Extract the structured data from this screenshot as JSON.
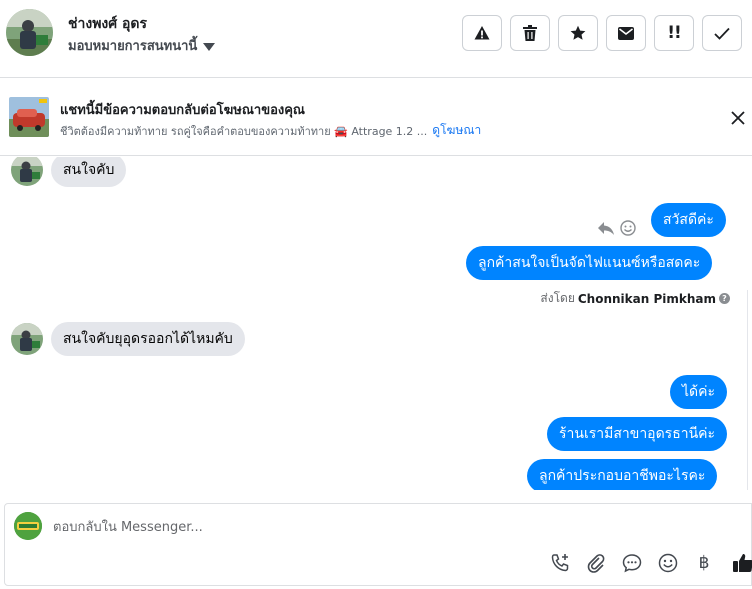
{
  "header": {
    "contact_name": "ช่างพงศ์ อุดร",
    "assign_label": "มอบหมายการสนทนานี้",
    "actions": [
      {
        "name": "spam",
        "icon": "warning-icon"
      },
      {
        "name": "delete",
        "icon": "trash-icon"
      },
      {
        "name": "star",
        "icon": "star-icon"
      },
      {
        "name": "mark-unread",
        "icon": "envelope-icon"
      },
      {
        "name": "follow-up",
        "icon": "exclamation-icon",
        "label": "!!"
      },
      {
        "name": "done",
        "icon": "check-icon"
      }
    ]
  },
  "ad": {
    "title": "แชทนี้มีข้อความตอบกลับต่อโฆษณาของคุณ",
    "subtitle": "ชีวิตต้องมีความท้าทาย รถคู่ใจคือคำตอบของความท้าทาย 🚘 Attrage 1.2 ...",
    "link": "ดูโฆษณา"
  },
  "messages": [
    {
      "from": "customer",
      "text": "สนใจคับ"
    },
    {
      "from": "page",
      "text": "สวัสดีค่ะ"
    },
    {
      "from": "page",
      "text": "ลูกค้าสนใจเป็นจัดไฟแนนซ์หรือสดคะ"
    },
    {
      "from": "customer",
      "text": "สนใจคับยุอุดรออกได้ไหมคับ"
    },
    {
      "from": "page",
      "text": "ได้ค่ะ"
    },
    {
      "from": "page",
      "text": "ร้านเรามีสาขาอุดรธานีค่ะ"
    },
    {
      "from": "page",
      "text": "ลูกค้าประกอบอาชีพอะไรคะ"
    }
  ],
  "sent_by": {
    "prefix": "ส่งโดย",
    "name": "Chonnikan Pimkham"
  },
  "composer": {
    "placeholder": "ตอบกลับใน Messenger...",
    "currency_symbol": "฿"
  },
  "colors": {
    "brand_blue": "#0084ff",
    "link_blue": "#1877f2",
    "incoming_bubble": "#e4e6eb"
  }
}
